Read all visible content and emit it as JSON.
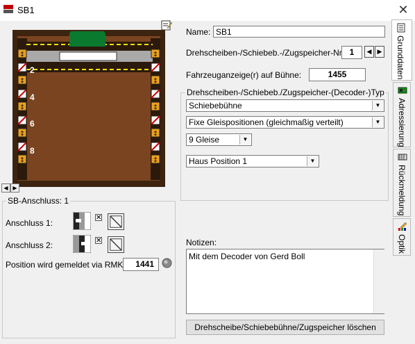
{
  "window": {
    "title": "SB1",
    "close_glyph": "✕"
  },
  "diagram": {
    "track_labels": [
      "2",
      "4",
      "6",
      "8"
    ],
    "colors": {
      "pit": "#7a4420",
      "frame": "#3d2410",
      "track": "#a9a9a9",
      "bridge_marker": "#0a7a2f",
      "warning_line": "#f5e400"
    }
  },
  "sb_anschluss": {
    "legend": "SB-Anschluss: 1",
    "anschluss1_label": "Anschluss 1:",
    "anschluss2_label": "Anschluss 2:",
    "rmk_label": "Position wird gemeldet via RMK:",
    "rmk_value": "1441"
  },
  "form": {
    "name_label": "Name:",
    "name_value": "SB1",
    "nr_label": "Drehscheiben-/Schiebeb.-/Zugspeicher-Nr.:",
    "nr_value": "1",
    "fahrzeug_label": "Fahrzeuganzeige(r) auf Bühne:",
    "fahrzeug_value": "1455",
    "type_legend": "Drehscheiben-/Schiebeb./Zugspeicher-(Decoder-)Typ",
    "type_select": "Schiebebühne",
    "positions_select": "Fixe Gleispositionen (gleichmaßig verteilt)",
    "gleise_select": "9 Gleise",
    "haus_select": "Haus Position 1",
    "notes_label": "Notizen:",
    "notes_value": "Mit dem Decoder von Gerd Boll",
    "delete_button": "Drehscheibe/Schiebebühne/Zugspeicher löschen"
  },
  "tabs": [
    {
      "label": "Grunddaten",
      "icon": "document-icon",
      "active": true
    },
    {
      "label": "Adressierung",
      "icon": "decoder-chip-icon",
      "active": false
    },
    {
      "label": "Rückmeldung",
      "icon": "feedback-module-icon",
      "active": false
    },
    {
      "label": "Optik",
      "icon": "brush-palette-icon",
      "active": false
    }
  ]
}
